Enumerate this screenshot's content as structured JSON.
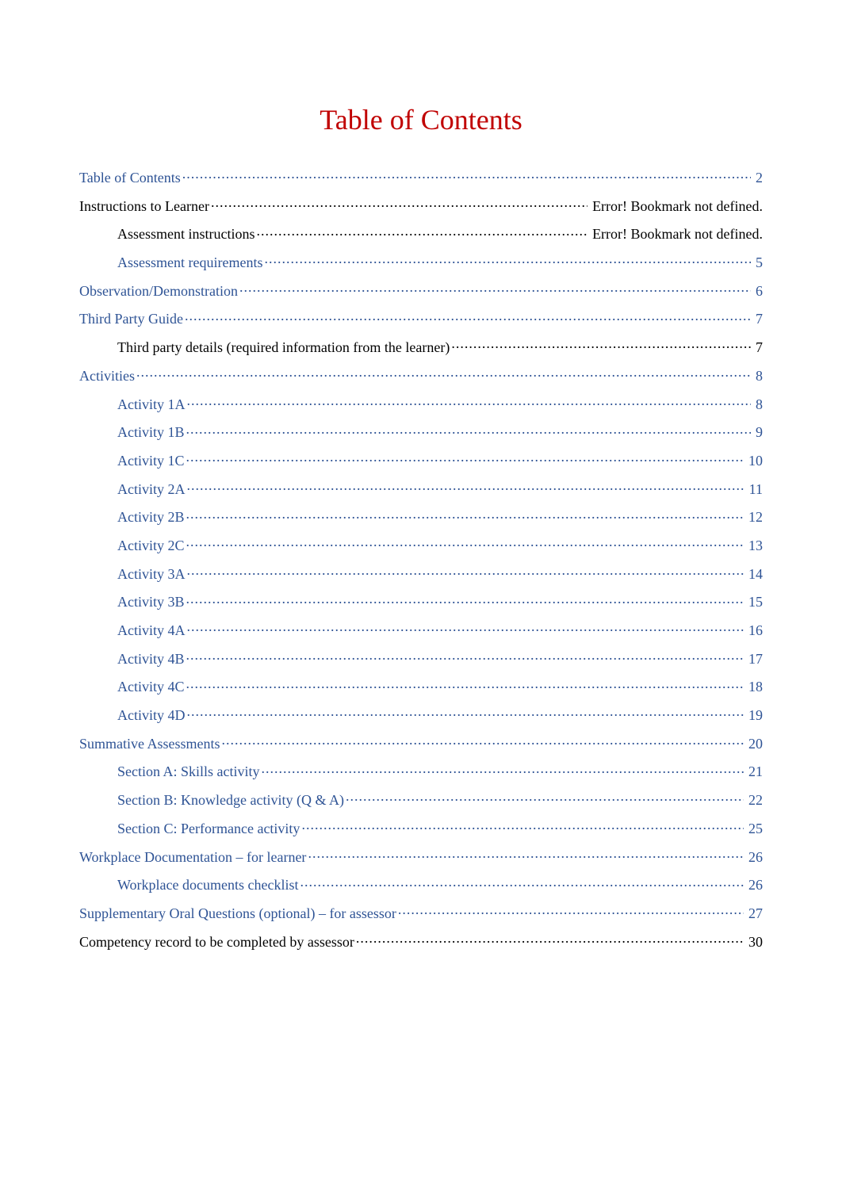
{
  "title": "Table of Contents",
  "colors": {
    "title": "#c00000",
    "link": "#2e5395",
    "text": "#000000"
  },
  "toc": [
    {
      "label": "Table of Contents",
      "page": "2",
      "level": 1,
      "link": true
    },
    {
      "label": "Instructions to Learner",
      "page": "Error! Bookmark not defined.",
      "level": 1,
      "link": false
    },
    {
      "label": "Assessment instructions",
      "page": "Error! Bookmark not defined.",
      "level": 2,
      "link": false
    },
    {
      "label": "Assessment requirements",
      "page": "5",
      "level": 2,
      "link": true
    },
    {
      "label": "Observation/Demonstration",
      "page": "6",
      "level": 1,
      "link": true
    },
    {
      "label": "Third Party Guide",
      "page": "7",
      "level": 1,
      "link": true
    },
    {
      "label": "Third party details (required information from the learner)",
      "page": "7",
      "level": 2,
      "link": false
    },
    {
      "label": "Activities",
      "page": "8",
      "level": 1,
      "link": true
    },
    {
      "label": "Activity 1A",
      "page": "8",
      "level": 2,
      "link": true
    },
    {
      "label": "Activity 1B",
      "page": "9",
      "level": 2,
      "link": true
    },
    {
      "label": "Activity 1C",
      "page": "10",
      "level": 2,
      "link": true
    },
    {
      "label": "Activity 2A",
      "page": "11",
      "level": 2,
      "link": true
    },
    {
      "label": "Activity 2B",
      "page": "12",
      "level": 2,
      "link": true
    },
    {
      "label": "Activity 2C",
      "page": "13",
      "level": 2,
      "link": true
    },
    {
      "label": "Activity 3A",
      "page": "14",
      "level": 2,
      "link": true
    },
    {
      "label": "Activity 3B",
      "page": "15",
      "level": 2,
      "link": true
    },
    {
      "label": "Activity 4A",
      "page": "16",
      "level": 2,
      "link": true
    },
    {
      "label": "Activity 4B",
      "page": "17",
      "level": 2,
      "link": true
    },
    {
      "label": "Activity 4C",
      "page": "18",
      "level": 2,
      "link": true
    },
    {
      "label": "Activity 4D",
      "page": "19",
      "level": 2,
      "link": true
    },
    {
      "label": "Summative Assessments",
      "page": "20",
      "level": 1,
      "link": true
    },
    {
      "label": "Section A: Skills activity",
      "page": "21",
      "level": 2,
      "link": true
    },
    {
      "label": "Section B: Knowledge activity (Q & A)",
      "page": "22",
      "level": 2,
      "link": true
    },
    {
      "label": "Section C: Performance activity",
      "page": "25",
      "level": 2,
      "link": true
    },
    {
      "label": "Workplace Documentation  – for learner",
      "page": "26",
      "level": 1,
      "link": true
    },
    {
      "label": "Workplace documents checklist",
      "page": "26",
      "level": 2,
      "link": true
    },
    {
      "label": "Supplementary  Oral Questions (optional) –  for assessor",
      "page": "27",
      "level": 1,
      "link": true
    },
    {
      "label": "Competency record to be completed by assessor",
      "page": "30",
      "level": 1,
      "link": false
    }
  ]
}
